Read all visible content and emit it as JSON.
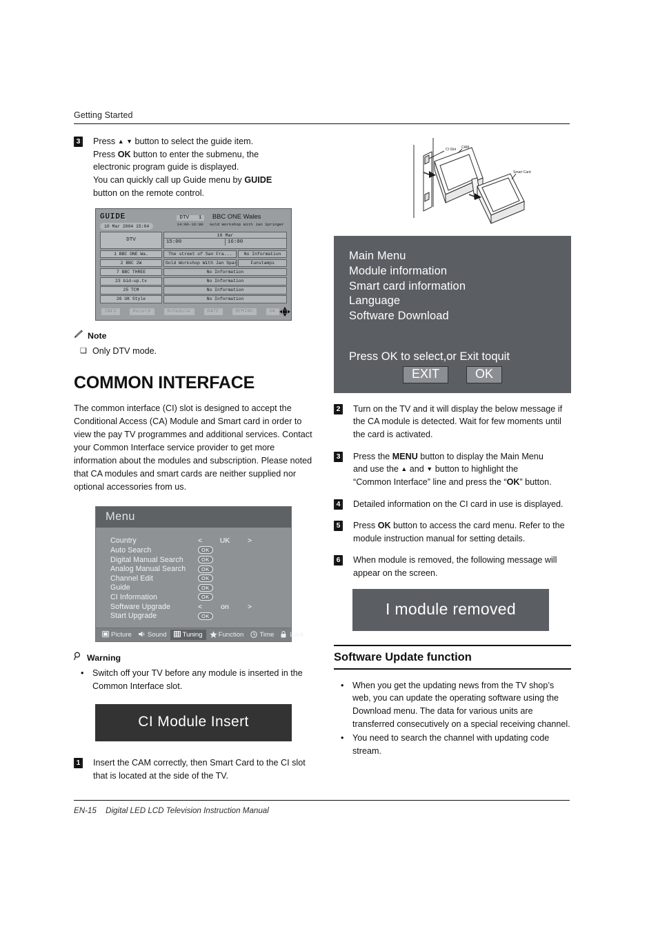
{
  "header": {
    "title": "Getting Started"
  },
  "footer": {
    "page": "EN-15",
    "title": "Digital LED LCD Television Instruction Manual"
  },
  "left": {
    "step3": {
      "num": "3",
      "line1_a": "Press",
      "line1_b": "button to select the guide item.",
      "line2_a": "Press",
      "line2_bold": "OK",
      "line2_b": "button to enter the submenu, the",
      "line3": "electronic program guide is displayed.",
      "line4_a": "You can quickly call up Guide menu by",
      "line4_bold": "GUIDE",
      "line5": "button on the remote control."
    },
    "guide": {
      "title": "GUIDE",
      "datetime": "10 Mar 2004 15:04",
      "now_source": "DTV",
      "now_number": "1",
      "now_channel": "BBC ONE Wales",
      "now_time": "14:00-16:00",
      "now_programme": "Gold Workshop With Jan Springer",
      "col_source": "DTV",
      "grid_date": "10 Mar",
      "slot1": "15:00",
      "slot2": "16:00",
      "rows": [
        {
          "channel": "1 BBC ONE Wa.",
          "cells": [
            "The street of San Fra...",
            "No Information"
          ]
        },
        {
          "channel": "2 BBC 2W",
          "cells": [
            "Gold Workshop With Jan Sparinger",
            "Funstamps"
          ]
        },
        {
          "channel": "7 BBC THREE",
          "cells": [
            "No Information"
          ]
        },
        {
          "channel": "23 bid-up.tv",
          "cells": [
            "No Information"
          ]
        },
        {
          "channel": "25 TCM",
          "cells": [
            "No Information"
          ]
        },
        {
          "channel": "26 UK Style",
          "cells": [
            "No Information"
          ]
        }
      ],
      "buttons": [
        "INFO",
        "Record",
        "Schedule",
        "DATE",
        "REMIND",
        "OK"
      ]
    },
    "note": {
      "label": "Note",
      "items": [
        "Only DTV mode."
      ]
    },
    "heading": "COMMON INTERFACE",
    "intro": "The common interface (CI) slot is designed to accept the Conditional Access (CA) Module and Smart card in order to view the pay TV programmes and additional services. Contact your Common Interface service provider to get more information about the modules and subscription. Please noted that CA modules and smart cards are neither supplied nor optional accessories from us.",
    "tv_menu": {
      "title": "Menu",
      "rows": [
        {
          "name": "Country",
          "type": "select",
          "left": "<",
          "value": "UK",
          "right": ">"
        },
        {
          "name": "Auto Search",
          "type": "ok",
          "value": "OK"
        },
        {
          "name": "Digital Manual Search",
          "type": "ok",
          "value": "OK"
        },
        {
          "name": "Analog Manual Search",
          "type": "ok",
          "value": "OK"
        },
        {
          "name": "Channel Edit",
          "type": "ok",
          "value": "OK"
        },
        {
          "name": "Guide",
          "type": "ok",
          "value": "OK"
        },
        {
          "name": "CI Information",
          "type": "ok",
          "value": "OK"
        },
        {
          "name": "Software Upgrade",
          "type": "select",
          "left": "<",
          "value": "on",
          "right": ">"
        },
        {
          "name": "Start Upgrade",
          "type": "ok",
          "value": "OK"
        }
      ],
      "tabs": [
        {
          "label": "Picture",
          "icon": "picture-icon",
          "active": false
        },
        {
          "label": "Sound",
          "icon": "sound-icon",
          "active": false
        },
        {
          "label": "Tuning",
          "icon": "tuning-icon",
          "active": true
        },
        {
          "label": "Function",
          "icon": "function-star-icon",
          "active": false
        },
        {
          "label": "Time",
          "icon": "clock-icon",
          "active": false
        },
        {
          "label": "Lock",
          "icon": "lock-icon",
          "active": false
        }
      ]
    },
    "warning": {
      "label": "Warning",
      "items": [
        "Switch off your TV before any module is inserted in the Common Interface slot."
      ]
    },
    "osd_insert": "CI Module Insert",
    "step1": {
      "num": "1",
      "text": "Insert the CAM correctly, then Smart Card to the CI slot that is located at the side of the TV."
    }
  },
  "right": {
    "diagram": {
      "label_ci_slot": "CI Slot",
      "label_cam": "CAM",
      "label_smart_card": "Smart Card"
    },
    "osd_main_menu": {
      "items": [
        "Main Menu",
        "Module information",
        "Smart card information",
        "Language",
        "Software Download"
      ],
      "prompt": "Press OK to select,or Exit toquit",
      "btn_exit": "EXIT",
      "btn_ok": "OK"
    },
    "steps": [
      {
        "num": "2",
        "text": "Turn on the TV and it will display the below message if the CA module is detected. Wait for few moments until the card is activated."
      },
      {
        "num": "4",
        "text": "Detailed information on the CI card in use is displayed."
      },
      {
        "num": "6",
        "text": "When module is removed, the following message will appear on the screen."
      }
    ],
    "step3": {
      "num": "3",
      "a": "Press the",
      "bold1": "MENU",
      "b": "button to display the Main Menu",
      "c": "and use the",
      "d": "and",
      "e": "button to highlight the",
      "f": "“Common Interface” line and press the “",
      "bold2": "OK",
      "g": "” button."
    },
    "step5": {
      "num": "5",
      "a": "Press",
      "bold": "OK",
      "b": "button to access the card menu. Refer to the module instruction manual for setting details."
    },
    "osd_removed": "I module removed",
    "subheading": "Software Update function",
    "bullets": [
      "When you get the updating news from the TV shop’s web, you can update the operating software using the Download menu. The data for various units are transferred consecutively on a special receiving channel.",
      "You need to search the channel with updating code stream."
    ]
  },
  "colors": {
    "osd_dark": "#333333",
    "osd_grey": "#5b5f63",
    "menu_bg": "#8e9295",
    "guide_bg": "#9a9ea1"
  }
}
